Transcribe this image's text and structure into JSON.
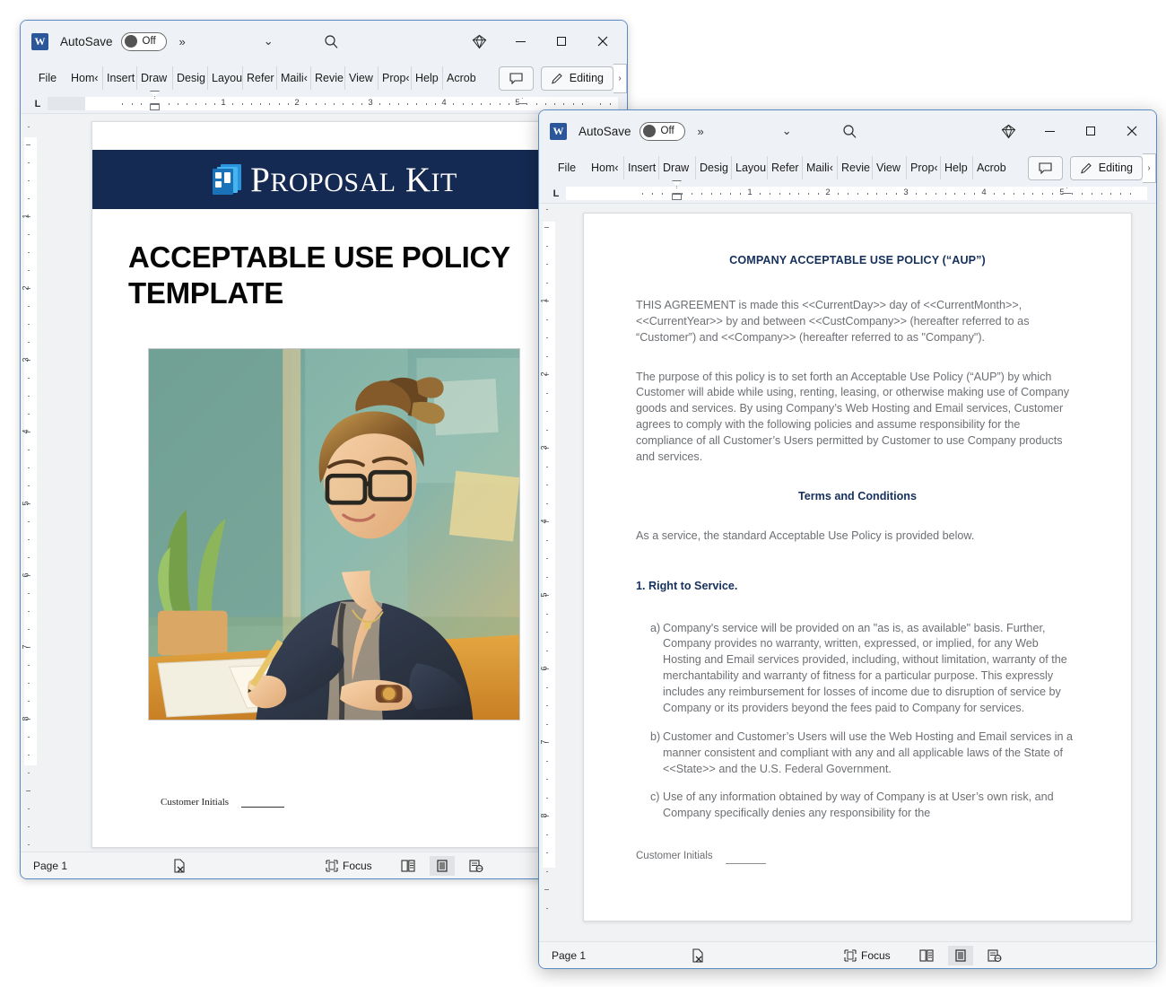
{
  "app": {
    "name": "Microsoft Word",
    "logo_letter": "W",
    "autosave_label": "AutoSave",
    "autosave_state": "Off",
    "overflow_chevron": "»",
    "qat_chevron": "⌄",
    "search_icon": "search-icon",
    "copilot_icon": "copilot-diamond-icon",
    "minimize": "─",
    "maximize": "□",
    "close": "✕"
  },
  "ribbon": {
    "tabs": [
      "File",
      "Hom‹",
      "Insert",
      "Draw",
      "Desig",
      "Layou",
      "Refer",
      "Maili‹",
      "Revie",
      "View",
      "Prop‹",
      "Help",
      "Acrob"
    ],
    "comment_label": "",
    "editing_label": "Editing",
    "editing_caret": "›"
  },
  "ruler": {
    "left_tab_marker": "L",
    "numbers": [
      "1",
      "2",
      "3",
      "4",
      "5"
    ],
    "vertical_numbers": [
      "1",
      "2",
      "3",
      "4",
      "5",
      "6",
      "7",
      "8"
    ]
  },
  "statusbar": {
    "page": "Page 1",
    "proofing_icon": "proofing-errors-icon",
    "focus_label": "Focus",
    "focus_icon": "focus-mode-icon",
    "view_read": "read-mode-icon",
    "view_print": "print-layout-icon",
    "view_web": "web-layout-icon"
  },
  "cover_document": {
    "brand": {
      "word_1": "P",
      "word_1_rest": "ROPOSAL",
      "word_2": "K",
      "word_2_rest": "I",
      "word_2_last": "T",
      "full": "PROPOSAL KIT",
      "banner_color": "#152a52"
    },
    "title": "ACCEPTABLE USE POLICY TEMPLATE",
    "image_alt": "Illustration of a woman with glasses writing at a desk",
    "initials_label": "Customer Initials"
  },
  "contract_document": {
    "heading": "COMPANY ACCEPTABLE USE POLICY (“AUP”)",
    "intro": "THIS AGREEMENT is made this <<CurrentDay>> day of <<CurrentMonth>>, <<CurrentYear>> by and between <<CustCompany>> (hereafter referred to as “Customer”) and <<Company>> (hereafter referred to as \"Company\").",
    "purpose": "The purpose of this policy is to set forth an Acceptable Use Policy (“AUP”) by which Customer will abide while using, renting, leasing, or otherwise making use of Company goods and services. By using Company’s Web Hosting and Email services, Customer agrees to comply with the following policies and assume responsibility for the compliance of all Customer’s Users permitted by Customer to use Company products and services.",
    "terms_heading": "Terms and Conditions",
    "service_line": "As a service, the standard Acceptable Use Policy is provided below.",
    "section_1": "1. Right to Service.",
    "items": [
      {
        "marker": "a)",
        "text": "Company's service will be provided on an \"as is, as available\" basis. Further, Company provides no warranty, written, expressed, or implied, for any Web Hosting and Email services provided, including, without limitation, warranty of the merchantability and warranty of fitness for a particular purpose. This expressly includes any reimbursement for losses of income due to disruption of service by Company or its providers beyond the fees paid to Company for services."
      },
      {
        "marker": "b)",
        "text": "Customer and Customer’s Users will use the Web Hosting and Email services in a manner consistent and compliant with any and all applicable laws of the State of <<State>> and the U.S. Federal Government."
      },
      {
        "marker": "c)",
        "text": "Use of any information obtained by way of Company is at User’s own risk, and Company specifically denies any responsibility for the"
      }
    ],
    "initials_label": "Customer Initials"
  },
  "colors": {
    "title_blue": "#16305c",
    "body_gray": "#6c6f73",
    "window_chrome": "#eef1f5",
    "window_border": "#5a8ac4",
    "banner_navy": "#152a52"
  }
}
